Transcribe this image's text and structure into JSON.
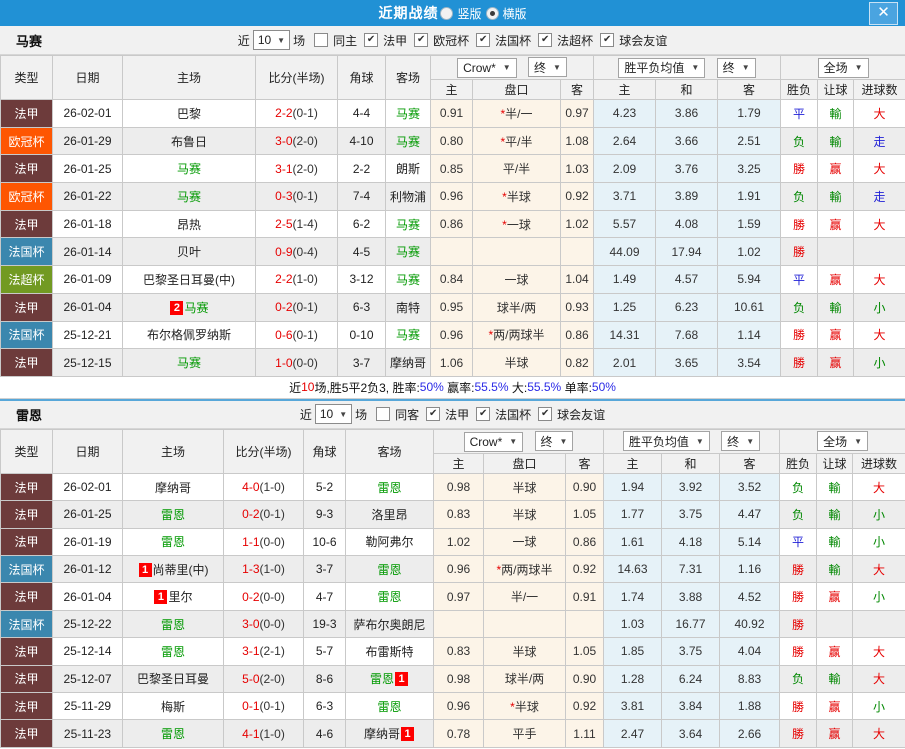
{
  "titlebar": {
    "title": "近期战绩",
    "vertical_label": "竖版",
    "horizontal_label": "横版"
  },
  "icons": {
    "dropdown_arrow": "▼",
    "check": "✔",
    "close": "✕"
  },
  "columns": {
    "type": "类型",
    "date": "日期",
    "home": "主场",
    "score": "比分(半场)",
    "corner": "角球",
    "away": "客场",
    "odds_home": "主",
    "handicap": "盘口",
    "odds_away": "客",
    "avg_home": "主",
    "avg_draw": "和",
    "avg_away": "客",
    "result": "胜负",
    "handicap_result": "让球",
    "goals": "进球数"
  },
  "dropdowns": {
    "odds_source": "Crow*",
    "odds_final": "终",
    "avg_label": "胜平负均值",
    "avg_final": "终",
    "scope": "全场"
  },
  "team1_filter": {
    "team": "马赛",
    "near": "近",
    "count": "10",
    "unit": "场",
    "same": "同主",
    "leagues": [
      "法甲",
      "欧冠杯",
      "法国杯",
      "法超杯",
      "球会友谊"
    ]
  },
  "team2_filter": {
    "team": "雷恩",
    "near": "近",
    "count": "10",
    "unit": "场",
    "same": "同客",
    "leagues": [
      "法甲",
      "法国杯",
      "球会友谊"
    ]
  },
  "league_colors": {
    "法甲": "#6d3b3b",
    "欧冠杯": "#fe5602",
    "法国杯": "#3b87ae",
    "法超杯": "#729a22"
  },
  "result_colors": {
    "勝": "#e60000",
    "赢": "#e60000",
    "大": "#e60000",
    "负": "#008800",
    "輸": "#008800",
    "小": "#008800",
    "平": "#1f1fd6",
    "走": "#1f1fd6"
  },
  "accent": {
    "self_team": "#009900",
    "score_red": "#e60000",
    "badge_bg": "#fe0000",
    "header_blue": "#2191d5"
  },
  "table1_rows": [
    {
      "lg": "法甲",
      "date": "26-02-01",
      "home": {
        "t": "巴黎"
      },
      "sc": "2-2",
      "hf": "(0-1)",
      "cn": "4-4",
      "away": {
        "t": "马赛",
        "self": true
      },
      "o1": "0.91",
      "pk": "*半/一",
      "o2": "0.97",
      "m1": "4.23",
      "m2": "3.86",
      "m3": "1.79",
      "r": "平",
      "hr": "輸",
      "gl": "大"
    },
    {
      "lg": "欧冠杯",
      "date": "26-01-29",
      "home": {
        "t": "布鲁日"
      },
      "sc": "3-0",
      "hf": "(2-0)",
      "cn": "4-10",
      "away": {
        "t": "马赛",
        "self": true
      },
      "o1": "0.80",
      "pk": "*平/半",
      "o2": "1.08",
      "m1": "2.64",
      "m2": "3.66",
      "m3": "2.51",
      "r": "负",
      "hr": "輸",
      "gl": "走"
    },
    {
      "lg": "法甲",
      "date": "26-01-25",
      "home": {
        "t": "马赛",
        "self": true
      },
      "sc": "3-1",
      "hf": "(2-0)",
      "cn": "2-2",
      "away": {
        "t": "朗斯"
      },
      "o1": "0.85",
      "pk": "平/半",
      "o2": "1.03",
      "m1": "2.09",
      "m2": "3.76",
      "m3": "3.25",
      "r": "勝",
      "hr": "赢",
      "gl": "大"
    },
    {
      "lg": "欧冠杯",
      "date": "26-01-22",
      "home": {
        "t": "马赛",
        "self": true
      },
      "sc": "0-3",
      "hf": "(0-1)",
      "cn": "7-4",
      "away": {
        "t": "利物浦"
      },
      "o1": "0.96",
      "pk": "*半球",
      "o2": "0.92",
      "m1": "3.71",
      "m2": "3.89",
      "m3": "1.91",
      "r": "负",
      "hr": "輸",
      "gl": "走"
    },
    {
      "lg": "法甲",
      "date": "26-01-18",
      "home": {
        "t": "昂热"
      },
      "sc": "2-5",
      "hf": "(1-4)",
      "cn": "6-2",
      "away": {
        "t": "马赛",
        "self": true
      },
      "o1": "0.86",
      "pk": "*一球",
      "o2": "1.02",
      "m1": "5.57",
      "m2": "4.08",
      "m3": "1.59",
      "r": "勝",
      "hr": "赢",
      "gl": "大"
    },
    {
      "lg": "法国杯",
      "date": "26-01-14",
      "home": {
        "t": "贝叶"
      },
      "sc": "0-9",
      "hf": "(0-4)",
      "cn": "4-5",
      "away": {
        "t": "马赛",
        "self": true
      },
      "o1": "",
      "pk": "",
      "o2": "",
      "m1": "44.09",
      "m2": "17.94",
      "m3": "1.02",
      "r": "勝",
      "hr": "",
      "gl": ""
    },
    {
      "lg": "法超杯",
      "date": "26-01-09",
      "home": {
        "t": "巴黎圣日耳曼(中)"
      },
      "sc": "2-2",
      "hf": "(1-0)",
      "cn": "3-12",
      "away": {
        "t": "马赛",
        "self": true
      },
      "o1": "0.84",
      "pk": "一球",
      "o2": "1.04",
      "m1": "1.49",
      "m2": "4.57",
      "m3": "5.94",
      "r": "平",
      "hr": "赢",
      "gl": "大"
    },
    {
      "lg": "法甲",
      "date": "26-01-04",
      "home": {
        "b": "2",
        "t": "马赛",
        "self": true
      },
      "sc": "0-2",
      "hf": "(0-1)",
      "cn": "6-3",
      "away": {
        "t": "南特"
      },
      "o1": "0.95",
      "pk": "球半/两",
      "o2": "0.93",
      "m1": "1.25",
      "m2": "6.23",
      "m3": "10.61",
      "r": "负",
      "hr": "輸",
      "gl": "小"
    },
    {
      "lg": "法国杯",
      "date": "25-12-21",
      "home": {
        "t": "布尔格佩罗纳斯"
      },
      "sc": "0-6",
      "hf": "(0-1)",
      "cn": "0-10",
      "away": {
        "t": "马赛",
        "self": true
      },
      "o1": "0.96",
      "pk": "*两/两球半",
      "o2": "0.86",
      "m1": "14.31",
      "m2": "7.68",
      "m3": "1.14",
      "r": "勝",
      "hr": "赢",
      "gl": "大"
    },
    {
      "lg": "法甲",
      "date": "25-12-15",
      "home": {
        "t": "马赛",
        "self": true
      },
      "sc": "1-0",
      "hf": "(0-0)",
      "cn": "3-7",
      "away": {
        "t": "摩纳哥"
      },
      "o1": "1.06",
      "pk": "半球",
      "o2": "0.82",
      "m1": "2.01",
      "m2": "3.65",
      "m3": "3.54",
      "r": "勝",
      "hr": "赢",
      "gl": "小"
    }
  ],
  "summary1": {
    "parts": [
      {
        "t": "近",
        "c": "#111"
      },
      {
        "t": "10",
        "c": "#e60000"
      },
      {
        "t": "场,胜5平2负3, 胜率:",
        "c": "#111"
      },
      {
        "t": "50%",
        "c": "#2a2ae6"
      },
      {
        "t": " 赢率:",
        "c": "#111"
      },
      {
        "t": "55.5%",
        "c": "#2a2ae6"
      },
      {
        "t": " 大:",
        "c": "#111"
      },
      {
        "t": "55.5%",
        "c": "#2a2ae6"
      },
      {
        "t": " 单率:",
        "c": "#111"
      },
      {
        "t": "50%",
        "c": "#2a2ae6"
      }
    ]
  },
  "table2_rows": [
    {
      "lg": "法甲",
      "date": "26-02-01",
      "home": {
        "t": "摩纳哥"
      },
      "sc": "4-0",
      "hf": "(1-0)",
      "cn": "5-2",
      "away": {
        "t": "雷恩",
        "self": true
      },
      "o1": "0.98",
      "pk": "半球",
      "o2": "0.90",
      "m1": "1.94",
      "m2": "3.92",
      "m3": "3.52",
      "r": "负",
      "hr": "輸",
      "gl": "大"
    },
    {
      "lg": "法甲",
      "date": "26-01-25",
      "home": {
        "t": "雷恩",
        "self": true
      },
      "sc": "0-2",
      "hf": "(0-1)",
      "cn": "9-3",
      "away": {
        "t": "洛里昂"
      },
      "o1": "0.83",
      "pk": "半球",
      "o2": "1.05",
      "m1": "1.77",
      "m2": "3.75",
      "m3": "4.47",
      "r": "负",
      "hr": "輸",
      "gl": "小"
    },
    {
      "lg": "法甲",
      "date": "26-01-19",
      "home": {
        "t": "雷恩",
        "self": true
      },
      "sc": "1-1",
      "hf": "(0-0)",
      "cn": "10-6",
      "away": {
        "t": "勒阿弗尔"
      },
      "o1": "1.02",
      "pk": "一球",
      "o2": "0.86",
      "m1": "1.61",
      "m2": "4.18",
      "m3": "5.14",
      "r": "平",
      "hr": "輸",
      "gl": "小"
    },
    {
      "lg": "法国杯",
      "date": "26-01-12",
      "home": {
        "b": "1",
        "t": "尚蒂里(中)"
      },
      "sc": "1-3",
      "hf": "(1-0)",
      "cn": "3-7",
      "away": {
        "t": "雷恩",
        "self": true
      },
      "o1": "0.96",
      "pk": "*两/两球半",
      "o2": "0.92",
      "m1": "14.63",
      "m2": "7.31",
      "m3": "1.16",
      "r": "勝",
      "hr": "輸",
      "gl": "大"
    },
    {
      "lg": "法甲",
      "date": "26-01-04",
      "home": {
        "b": "1",
        "t": "里尔"
      },
      "sc": "0-2",
      "hf": "(0-0)",
      "cn": "4-7",
      "away": {
        "t": "雷恩",
        "self": true
      },
      "o1": "0.97",
      "pk": "半/一",
      "o2": "0.91",
      "m1": "1.74",
      "m2": "3.88",
      "m3": "4.52",
      "r": "勝",
      "hr": "赢",
      "gl": "小"
    },
    {
      "lg": "法国杯",
      "date": "25-12-22",
      "home": {
        "t": "雷恩",
        "self": true
      },
      "sc": "3-0",
      "hf": "(0-0)",
      "cn": "19-3",
      "away": {
        "t": "萨布尔奥朗尼"
      },
      "o1": "",
      "pk": "",
      "o2": "",
      "m1": "1.03",
      "m2": "16.77",
      "m3": "40.92",
      "r": "勝",
      "hr": "",
      "gl": ""
    },
    {
      "lg": "法甲",
      "date": "25-12-14",
      "home": {
        "t": "雷恩",
        "self": true
      },
      "sc": "3-1",
      "hf": "(2-1)",
      "cn": "5-7",
      "away": {
        "t": "布雷斯特"
      },
      "o1": "0.83",
      "pk": "半球",
      "o2": "1.05",
      "m1": "1.85",
      "m2": "3.75",
      "m3": "4.04",
      "r": "勝",
      "hr": "赢",
      "gl": "大"
    },
    {
      "lg": "法甲",
      "date": "25-12-07",
      "home": {
        "t": "巴黎圣日耳曼"
      },
      "sc": "5-0",
      "hf": "(2-0)",
      "cn": "8-6",
      "away": {
        "t": "雷恩",
        "self": true,
        "ab": "1"
      },
      "o1": "0.98",
      "pk": "球半/两",
      "o2": "0.90",
      "m1": "1.28",
      "m2": "6.24",
      "m3": "8.83",
      "r": "负",
      "hr": "輸",
      "gl": "大"
    },
    {
      "lg": "法甲",
      "date": "25-11-29",
      "home": {
        "t": "梅斯"
      },
      "sc": "0-1",
      "hf": "(0-1)",
      "cn": "6-3",
      "away": {
        "t": "雷恩",
        "self": true
      },
      "o1": "0.96",
      "pk": "*半球",
      "o2": "0.92",
      "m1": "3.81",
      "m2": "3.84",
      "m3": "1.88",
      "r": "勝",
      "hr": "赢",
      "gl": "小"
    },
    {
      "lg": "法甲",
      "date": "25-11-23",
      "home": {
        "t": "雷恩",
        "self": true
      },
      "sc": "4-1",
      "hf": "(1-0)",
      "cn": "4-6",
      "away": {
        "t": "摩纳哥",
        "ab": "1"
      },
      "o1": "0.78",
      "pk": "平手",
      "o2": "1.11",
      "m1": "2.47",
      "m2": "3.64",
      "m3": "2.66",
      "r": "勝",
      "hr": "赢",
      "gl": "大"
    }
  ]
}
